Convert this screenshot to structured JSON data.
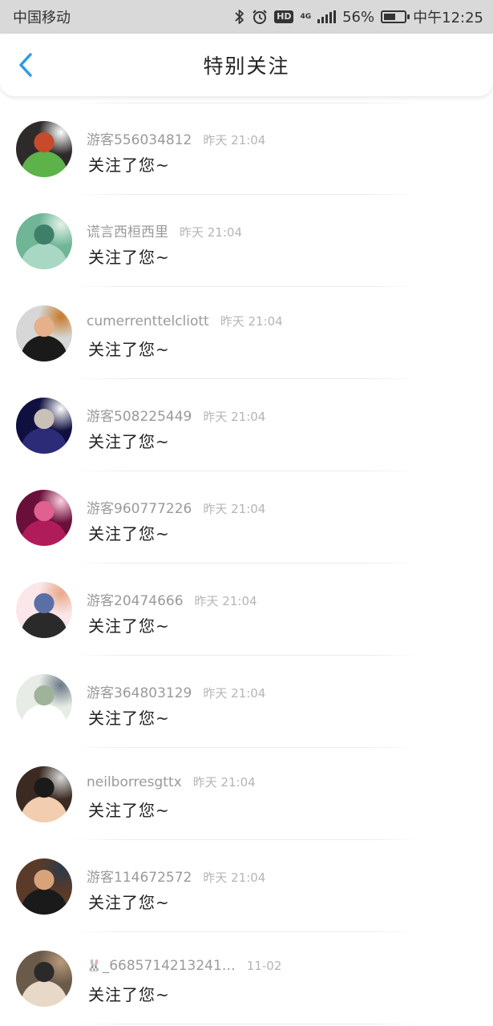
{
  "status_bar": {
    "carrier": "中国移动",
    "hd": "HD",
    "network": "4G",
    "battery_percent": "56%",
    "battery_level": 0.56,
    "time": "中午12:25"
  },
  "header": {
    "title": "特别关注"
  },
  "items": [
    {
      "name": "游客556034812",
      "time": "昨天 21:04",
      "message": "关注了您~",
      "avatar_colors": [
        "#2f2a2a",
        "#5db24a",
        "#c74a2a",
        "#ffffff"
      ]
    },
    {
      "name": "谎言西桓西里",
      "time": "昨天 21:04",
      "message": "关注了您~",
      "avatar_colors": [
        "#6fb596",
        "#a8d8c4",
        "#3e7f6a",
        "#e2f2ea"
      ]
    },
    {
      "name": "cumerrenttelcliott",
      "time": "昨天 21:04",
      "message": "关注了您~",
      "avatar_colors": [
        "#d7d7d7",
        "#1a1a1a",
        "#e6b08a",
        "#c77a2a"
      ]
    },
    {
      "name": "游客508225449",
      "time": "昨天 21:04",
      "message": "关注了您~",
      "avatar_colors": [
        "#101040",
        "#2b2b78",
        "#c9c0b8",
        "#ffffff"
      ]
    },
    {
      "name": "游客960777226",
      "time": "昨天 21:04",
      "message": "关注了您~",
      "avatar_colors": [
        "#6a0f3a",
        "#b01c5a",
        "#e06090",
        "#ffd0e0"
      ]
    },
    {
      "name": "游客20474666",
      "time": "昨天 21:04",
      "message": "关注了您~",
      "avatar_colors": [
        "#fbe7ea",
        "#2a2a2a",
        "#5a6fa6",
        "#e8a88a"
      ]
    },
    {
      "name": "游客364803129",
      "time": "昨天 21:04",
      "message": "关注了您~",
      "avatar_colors": [
        "#e8ece6",
        "#ffffff",
        "#9fb39a",
        "#6a7a88"
      ]
    },
    {
      "name": "neilborresgttx",
      "time": "昨天 21:04",
      "message": "关注了您~",
      "avatar_colors": [
        "#3a2a22",
        "#f2cdb0",
        "#1a1a1a",
        "#d8d8d8"
      ]
    },
    {
      "name": "游客114672572",
      "time": "昨天 21:04",
      "message": "关注了您~",
      "avatar_colors": [
        "#5a3a28",
        "#1a1a1a",
        "#d9a37a",
        "#2c3a4a"
      ]
    },
    {
      "name": "_6685714213241…",
      "time": "11-02",
      "message": "关注了您~",
      "avatar_colors": [
        "#6a5a4a",
        "#e8d8c8",
        "#2a2a2a",
        "#b89a7a"
      ],
      "prefix_emoji": "🐰"
    }
  ]
}
